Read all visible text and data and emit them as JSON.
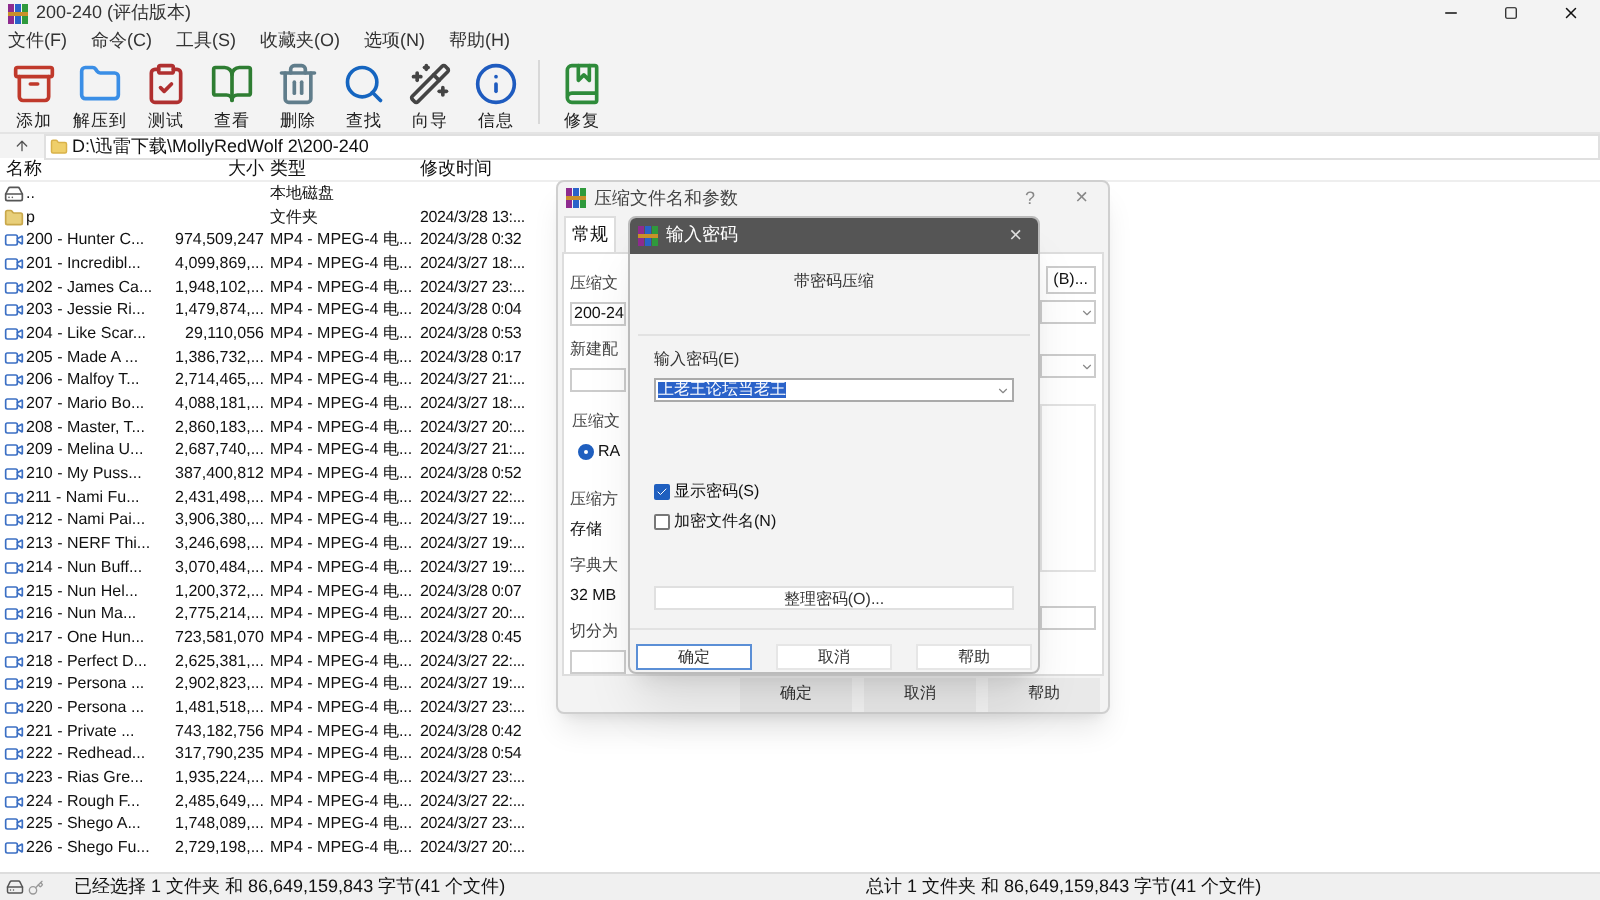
{
  "window": {
    "title": "200-240 (评估版本)"
  },
  "menu": [
    "文件(F)",
    "命令(C)",
    "工具(S)",
    "收藏夹(O)",
    "选项(N)",
    "帮助(H)"
  ],
  "toolbar": [
    {
      "kind": "add",
      "label": "添加"
    },
    {
      "kind": "extract",
      "label": "解压到"
    },
    {
      "kind": "test",
      "label": "测试"
    },
    {
      "kind": "view",
      "label": "查看"
    },
    {
      "kind": "delete",
      "label": "删除"
    },
    {
      "kind": "find",
      "label": "查找"
    },
    {
      "kind": "wizard",
      "label": "向导"
    },
    {
      "kind": "info",
      "label": "信息"
    },
    {
      "kind": "repair",
      "label": "修复"
    }
  ],
  "address": {
    "path": "D:\\迅雷下载\\MollyRedWolf 2\\200-240"
  },
  "table": {
    "columns": [
      "名称",
      "大小",
      "类型",
      "修改时间"
    ],
    "rows": [
      {
        "kind": "drive",
        "name": "..",
        "size": "",
        "type": "本地磁盘",
        "modified": ""
      },
      {
        "kind": "folder",
        "name": "p",
        "size": "",
        "type": "文件夹",
        "modified": "2024/3/28 13:..."
      },
      {
        "kind": "video",
        "name": "200 - Hunter C...",
        "size": "974,509,247",
        "type": "MP4 - MPEG-4 电...",
        "modified": "2024/3/28 0:32"
      },
      {
        "kind": "video",
        "name": "201 - Incredibl...",
        "size": "4,099,869,...",
        "type": "MP4 - MPEG-4 电...",
        "modified": "2024/3/27 18:..."
      },
      {
        "kind": "video",
        "name": "202 - James Ca...",
        "size": "1,948,102,...",
        "type": "MP4 - MPEG-4 电...",
        "modified": "2024/3/27 23:..."
      },
      {
        "kind": "video",
        "name": "203 - Jessie Ri...",
        "size": "1,479,874,...",
        "type": "MP4 - MPEG-4 电...",
        "modified": "2024/3/28 0:04"
      },
      {
        "kind": "video",
        "name": "204 - Like Scar...",
        "size": "29,110,056",
        "type": "MP4 - MPEG-4 电...",
        "modified": "2024/3/28 0:53"
      },
      {
        "kind": "video",
        "name": "205 - Made A ...",
        "size": "1,386,732,...",
        "type": "MP4 - MPEG-4 电...",
        "modified": "2024/3/28 0:17"
      },
      {
        "kind": "video",
        "name": "206 - Malfoy T...",
        "size": "2,714,465,...",
        "type": "MP4 - MPEG-4 电...",
        "modified": "2024/3/27 21:..."
      },
      {
        "kind": "video",
        "name": "207 - Mario Bo...",
        "size": "4,088,181,...",
        "type": "MP4 - MPEG-4 电...",
        "modified": "2024/3/27 18:..."
      },
      {
        "kind": "video",
        "name": "208 - Master, T...",
        "size": "2,860,183,...",
        "type": "MP4 - MPEG-4 电...",
        "modified": "2024/3/27 20:..."
      },
      {
        "kind": "video",
        "name": "209 - Melina U...",
        "size": "2,687,740,...",
        "type": "MP4 - MPEG-4 电...",
        "modified": "2024/3/27 21:..."
      },
      {
        "kind": "video",
        "name": "210 - My Puss...",
        "size": "387,400,812",
        "type": "MP4 - MPEG-4 电...",
        "modified": "2024/3/28 0:52"
      },
      {
        "kind": "video",
        "name": "211 - Nami Fu...",
        "size": "2,431,498,...",
        "type": "MP4 - MPEG-4 电...",
        "modified": "2024/3/27 22:..."
      },
      {
        "kind": "video",
        "name": "212 - Nami Pai...",
        "size": "3,906,380,...",
        "type": "MP4 - MPEG-4 电...",
        "modified": "2024/3/27 19:..."
      },
      {
        "kind": "video",
        "name": "213 - NERF Thi...",
        "size": "3,246,698,...",
        "type": "MP4 - MPEG-4 电...",
        "modified": "2024/3/27 19:..."
      },
      {
        "kind": "video",
        "name": "214 - Nun Buff...",
        "size": "3,070,484,...",
        "type": "MP4 - MPEG-4 电...",
        "modified": "2024/3/27 19:..."
      },
      {
        "kind": "video",
        "name": "215 - Nun Hel...",
        "size": "1,200,372,...",
        "type": "MP4 - MPEG-4 电...",
        "modified": "2024/3/28 0:07"
      },
      {
        "kind": "video",
        "name": "216 - Nun Ma...",
        "size": "2,775,214,...",
        "type": "MP4 - MPEG-4 电...",
        "modified": "2024/3/27 20:..."
      },
      {
        "kind": "video",
        "name": "217 - One Hun...",
        "size": "723,581,070",
        "type": "MP4 - MPEG-4 电...",
        "modified": "2024/3/28 0:45"
      },
      {
        "kind": "video",
        "name": "218 - Perfect D...",
        "size": "2,625,381,...",
        "type": "MP4 - MPEG-4 电...",
        "modified": "2024/3/27 22:..."
      },
      {
        "kind": "video",
        "name": "219 - Persona ...",
        "size": "2,902,823,...",
        "type": "MP4 - MPEG-4 电...",
        "modified": "2024/3/27 19:..."
      },
      {
        "kind": "video",
        "name": "220 - Persona ...",
        "size": "1,481,518,...",
        "type": "MP4 - MPEG-4 电...",
        "modified": "2024/3/27 23:..."
      },
      {
        "kind": "video",
        "name": "221 - Private ...",
        "size": "743,182,756",
        "type": "MP4 - MPEG-4 电...",
        "modified": "2024/3/28 0:42"
      },
      {
        "kind": "video",
        "name": "222 - Redhead...",
        "size": "317,790,235",
        "type": "MP4 - MPEG-4 电...",
        "modified": "2024/3/28 0:54"
      },
      {
        "kind": "video",
        "name": "223 - Rias Gre...",
        "size": "1,935,224,...",
        "type": "MP4 - MPEG-4 电...",
        "modified": "2024/3/27 23:..."
      },
      {
        "kind": "video",
        "name": "224 - Rough F...",
        "size": "2,485,649,...",
        "type": "MP4 - MPEG-4 电...",
        "modified": "2024/3/27 22:..."
      },
      {
        "kind": "video",
        "name": "225 - Shego A...",
        "size": "1,748,089,...",
        "type": "MP4 - MPEG-4 电...",
        "modified": "2024/3/27 23:..."
      },
      {
        "kind": "video",
        "name": "226 - Shego Fu...",
        "size": "2,729,198,...",
        "type": "MP4 - MPEG-4 电...",
        "modified": "2024/3/27 20:..."
      }
    ]
  },
  "status_bar": {
    "selection": "已经选择 1 文件夹 和 86,649,159,843 字节(41 个文件)",
    "total": "总计 1 文件夹 和 86,649,159,843 字节(41 个文件)"
  },
  "archive_dialog": {
    "title": "压缩文件名和参数",
    "help": "?",
    "close": "×",
    "tab": "常规",
    "left": [
      {
        "kind": "label",
        "text": "压缩文"
      },
      {
        "kind": "field",
        "text": "200-24"
      },
      {
        "kind": "label",
        "text": "新建配"
      },
      {
        "kind": "field"
      },
      {
        "kind": "group",
        "text": "压缩文"
      },
      {
        "kind": "radio",
        "text": "RA",
        "checked": true
      },
      {
        "kind": "label",
        "text": "压缩方"
      },
      {
        "kind": "value",
        "text": "存储"
      },
      {
        "kind": "label",
        "text": "字典大"
      },
      {
        "kind": "value",
        "text": "32 MB"
      },
      {
        "kind": "label",
        "text": "切分为"
      }
    ],
    "browse_button": "(B)...",
    "buttons": [
      "确定",
      "取消",
      "帮助"
    ]
  },
  "password_dialog": {
    "title": "输入密码",
    "close": "×",
    "heading": "带密码压缩",
    "field_label": "输入密码(E)",
    "value": "上老王论坛当老王",
    "options": [
      {
        "label": "显示密码(S)",
        "checked": true
      },
      {
        "label": "加密文件名(N)",
        "checked": false
      }
    ],
    "organize_button": "整理密码(O)...",
    "buttons": [
      {
        "label": "确定",
        "selected": true
      },
      {
        "label": "取消",
        "selected": false
      },
      {
        "label": "帮助",
        "selected": false
      }
    ]
  }
}
